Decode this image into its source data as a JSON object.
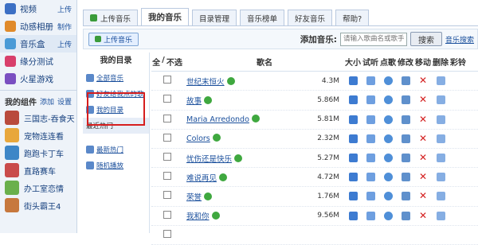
{
  "sidebar": {
    "apps": [
      {
        "label": "视频",
        "extra": "上传",
        "color": "#3b6fc4"
      },
      {
        "label": "动感相册",
        "extra": "制作",
        "color": "#e08a2a"
      },
      {
        "label": "音乐盒",
        "extra": "上传",
        "color": "#4a9ad6"
      },
      {
        "label": "缘分测试",
        "extra": "",
        "color": "#d83f6b"
      },
      {
        "label": "火星游戏",
        "extra": "",
        "color": "#7a4fc1"
      }
    ],
    "components_title": "我的组件",
    "components_add": "添加",
    "components_settings": "设置",
    "components": [
      {
        "label": "三国志-吞食天",
        "color": "#b94a3c"
      },
      {
        "label": "宠物连连看",
        "color": "#e8a73c"
      },
      {
        "label": "跑跑卡丁车",
        "color": "#3d86c7"
      },
      {
        "label": "直路赛车",
        "color": "#c94b4b"
      },
      {
        "label": "办工室恋情",
        "color": "#6ab04c"
      },
      {
        "label": "街头霸王4",
        "color": "#c7783d"
      }
    ]
  },
  "tabs": [
    "上传音乐",
    "我的音乐",
    "目录管理",
    "音乐榜单",
    "好友音乐",
    "帮助?"
  ],
  "toolbar": {
    "upload_button": "上传音乐",
    "add_label": "添加音乐:",
    "search_placeholder": "请输入歌曲名或歌手名",
    "search_button": "搜索",
    "search_link": "音乐搜索"
  },
  "directory": {
    "title": "我的目录",
    "items": [
      "全部音乐",
      "好友给我点的歌",
      "我的目录",
      "最近热门"
    ],
    "boxed": [
      "最新热门",
      "随机播放"
    ]
  },
  "table": {
    "headers": {
      "all": "全",
      "sep": "/",
      "none": "不选",
      "name": "歌名",
      "size": "大小",
      "listen": "试听",
      "order": "点歌",
      "edit": "修改",
      "move": "移动",
      "delete": "删除",
      "ringtone": "彩铃"
    },
    "rows": [
      {
        "name": "世纪末恒火",
        "size": "4.3M"
      },
      {
        "name": "故事",
        "size": "5.86M"
      },
      {
        "name": "Maria Arredondo",
        "size": "5.81M"
      },
      {
        "name": "Colors",
        "size": "2.32M"
      },
      {
        "name": "忧伤还是快乐",
        "size": "5.27M"
      },
      {
        "name": "难说再见",
        "size": "4.72M"
      },
      {
        "name": "荣誉",
        "size": "1.76M"
      },
      {
        "name": "我和你",
        "size": "9.56M"
      },
      {
        "name": "",
        "size": ""
      }
    ]
  }
}
